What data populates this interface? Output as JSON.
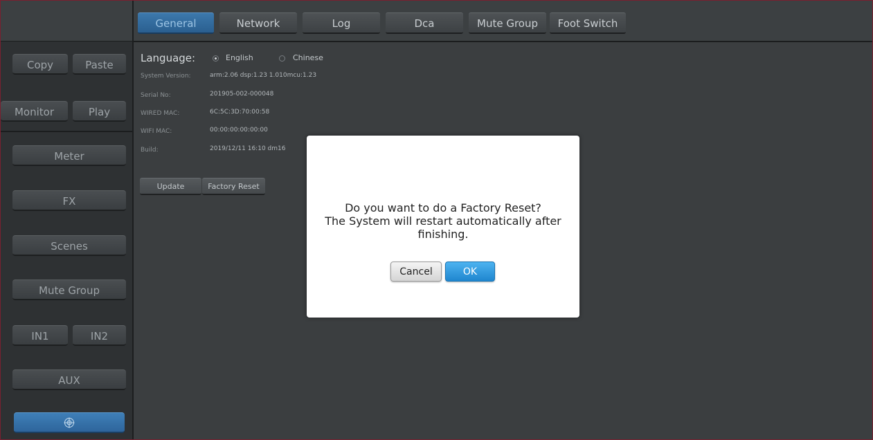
{
  "sidebar": {
    "copy": "Copy",
    "paste": "Paste",
    "monitor": "Monitor",
    "play": "Play",
    "meter": "Meter",
    "fx": "FX",
    "scenes": "Scenes",
    "mute_group": "Mute Group",
    "in1": "IN1",
    "in2": "IN2",
    "aux": "AUX",
    "bottom_icon": "target-icon"
  },
  "tabs": [
    {
      "label": "General",
      "active": true
    },
    {
      "label": "Network",
      "active": false
    },
    {
      "label": "Log",
      "active": false
    },
    {
      "label": "Dca",
      "active": false
    },
    {
      "label": "Mute Group",
      "active": false
    },
    {
      "label": "Foot Switch",
      "active": false
    }
  ],
  "general": {
    "language_label": "Language:",
    "language_options": [
      "English",
      "Chinese"
    ],
    "language_selected": "English",
    "info": [
      {
        "label": "System Version:",
        "value": "arm:2.06 dsp:1.23 1.010mcu:1.23"
      },
      {
        "label": "Serial No:",
        "value": "201905-002-000048"
      },
      {
        "label": "WIRED MAC:",
        "value": "6C:5C:3D:70:00:58"
      },
      {
        "label": "WIFI MAC:",
        "value": "00:00:00:00:00:00"
      },
      {
        "label": "Build:",
        "value": "2019/12/11 16:10 dm16"
      }
    ],
    "update_button": "Update",
    "factory_reset_button": "Factory Reset"
  },
  "dialog": {
    "line1": "Do you want to do a Factory Reset?",
    "line2": "The System will restart automatically after",
    "line3": "finishing.",
    "cancel": "Cancel",
    "ok": "OK"
  },
  "colors": {
    "accent": "#2e659b",
    "ok_button": "#1f86cf",
    "frame_border": "#7a2030"
  }
}
